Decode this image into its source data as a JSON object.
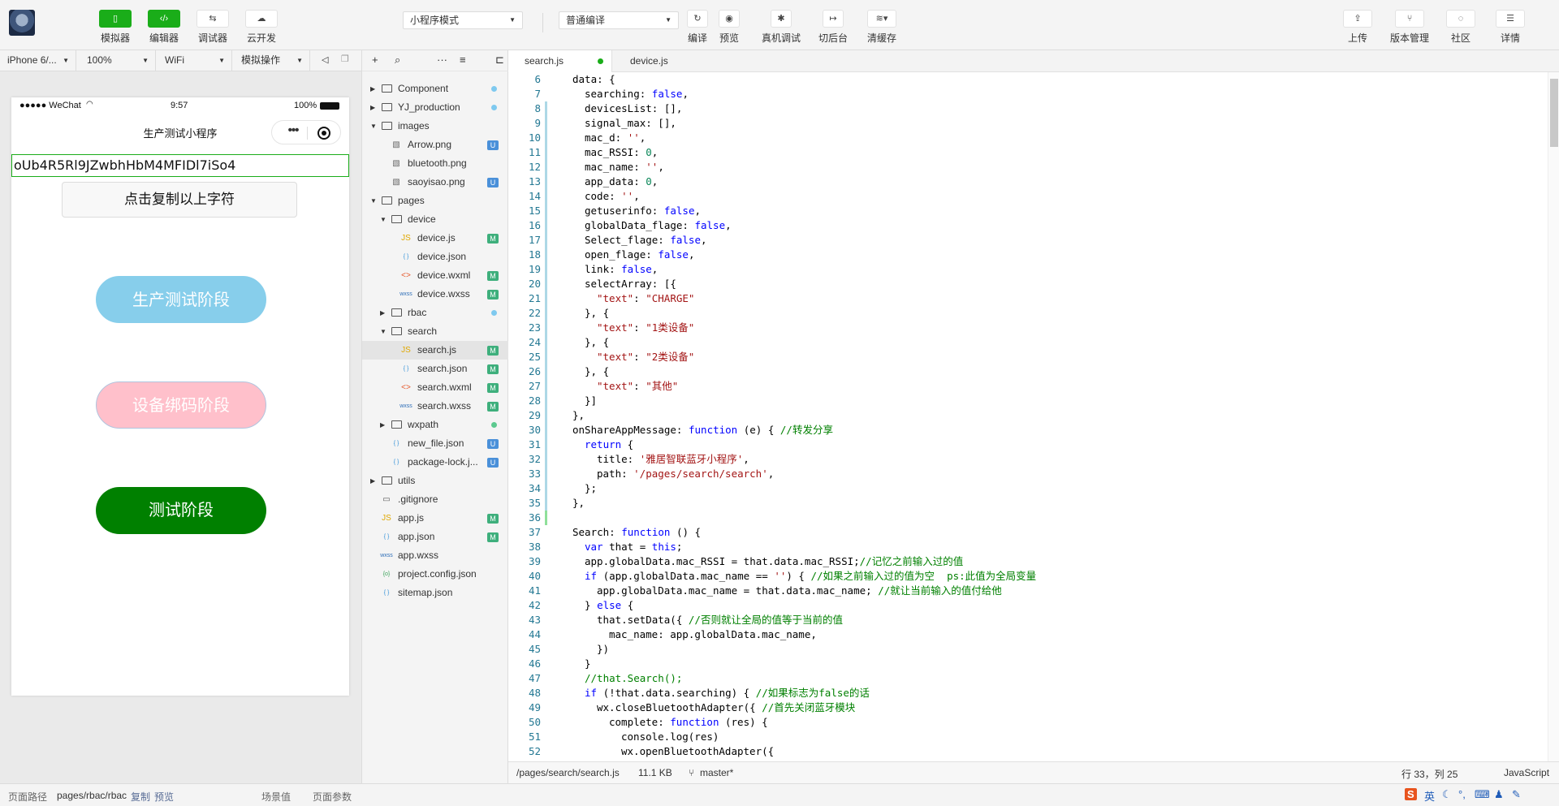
{
  "toolbar": {
    "left_buttons": [
      {
        "label": "模拟器",
        "icon": "phone-icon"
      },
      {
        "label": "编辑器",
        "icon": "code-icon"
      },
      {
        "label": "调试器",
        "icon": "debug-icon"
      },
      {
        "label": "云开发",
        "icon": "cloud-icon"
      }
    ],
    "mode_select": "小程序模式",
    "compile_select": "普通编译",
    "mid_buttons": [
      {
        "label": "编译",
        "icon": "refresh-icon"
      },
      {
        "label": "预览",
        "icon": "eye-icon"
      },
      {
        "label": "真机调试",
        "icon": "bug-icon"
      },
      {
        "label": "切后台",
        "icon": "background-icon"
      },
      {
        "label": "清缓存",
        "icon": "layers-icon"
      }
    ],
    "right_buttons": [
      {
        "label": "上传",
        "icon": "upload-icon"
      },
      {
        "label": "版本管理",
        "icon": "branch-icon"
      },
      {
        "label": "社区",
        "icon": "chat-icon"
      },
      {
        "label": "详情",
        "icon": "menu-icon"
      }
    ]
  },
  "simbar": {
    "device": "iPhone 6/...",
    "zoom": "100%",
    "network": "WiFi",
    "operation": "模拟操作"
  },
  "phone": {
    "carrier": "●●●●● WeChat",
    "time": "9:57",
    "battery": "100%",
    "nav_title": "生产测试小程序",
    "openid": "oUb4R5Rl9JZwbhHbM4MFIDl7iSo4",
    "copy_button": "点击复制以上字符",
    "btn_production": "生产测试阶段",
    "btn_binding": "设备绑码阶段",
    "btn_test": "测试阶段"
  },
  "explorer": {
    "tree": [
      {
        "name": "Component",
        "type": "folder",
        "depth": 0,
        "open": false,
        "badge": "dotblue"
      },
      {
        "name": "YJ_production",
        "type": "folder",
        "depth": 0,
        "open": false,
        "badge": "dotblue"
      },
      {
        "name": "images",
        "type": "folder",
        "depth": 0,
        "open": true,
        "badge": ""
      },
      {
        "name": "Arrow.png",
        "type": "img",
        "depth": 1,
        "badge": "U"
      },
      {
        "name": "bluetooth.png",
        "type": "img",
        "depth": 1,
        "badge": ""
      },
      {
        "name": "saoyisao.png",
        "type": "img",
        "depth": 1,
        "badge": "U"
      },
      {
        "name": "pages",
        "type": "folder",
        "depth": 0,
        "open": true,
        "badge": ""
      },
      {
        "name": "device",
        "type": "folder",
        "depth": 1,
        "open": true,
        "badge": ""
      },
      {
        "name": "device.js",
        "type": "js",
        "depth": 2,
        "badge": "M"
      },
      {
        "name": "device.json",
        "type": "json",
        "depth": 2,
        "badge": ""
      },
      {
        "name": "device.wxml",
        "type": "wxml",
        "depth": 2,
        "badge": "M"
      },
      {
        "name": "device.wxss",
        "type": "wxss",
        "depth": 2,
        "badge": "M"
      },
      {
        "name": "rbac",
        "type": "folder",
        "depth": 1,
        "open": false,
        "badge": "dotblue"
      },
      {
        "name": "search",
        "type": "folder",
        "depth": 1,
        "open": true,
        "badge": ""
      },
      {
        "name": "search.js",
        "type": "js",
        "depth": 2,
        "badge": "M",
        "active": true
      },
      {
        "name": "search.json",
        "type": "json",
        "depth": 2,
        "badge": "M"
      },
      {
        "name": "search.wxml",
        "type": "wxml",
        "depth": 2,
        "badge": "M"
      },
      {
        "name": "search.wxss",
        "type": "wxss",
        "depth": 2,
        "badge": "M"
      },
      {
        "name": "wxpath",
        "type": "folder",
        "depth": 1,
        "open": false,
        "badge": "dotgreen"
      },
      {
        "name": "new_file.json",
        "type": "json",
        "depth": 1,
        "badge": "U"
      },
      {
        "name": "package-lock.j...",
        "type": "json",
        "depth": 1,
        "badge": "U"
      },
      {
        "name": "utils",
        "type": "folder",
        "depth": 0,
        "open": false,
        "badge": ""
      },
      {
        "name": ".gitignore",
        "type": "file",
        "depth": 0,
        "badge": ""
      },
      {
        "name": "app.js",
        "type": "js",
        "depth": 0,
        "badge": "M"
      },
      {
        "name": "app.json",
        "type": "json",
        "depth": 0,
        "badge": "M"
      },
      {
        "name": "app.wxss",
        "type": "wxss",
        "depth": 0,
        "badge": ""
      },
      {
        "name": "project.config.json",
        "type": "cfg",
        "depth": 0,
        "badge": ""
      },
      {
        "name": "sitemap.json",
        "type": "json",
        "depth": 0,
        "badge": ""
      }
    ]
  },
  "editor": {
    "tabs": [
      {
        "label": "search.js",
        "active": true,
        "modified": true
      },
      {
        "label": "device.js",
        "active": false,
        "modified": false
      }
    ],
    "lines": [
      {
        "n": "6",
        "g": "",
        "ind": 0,
        "parts": [
          [
            "",
            "data: {"
          ]
        ]
      },
      {
        "n": "7",
        "g": "",
        "ind": 1,
        "parts": [
          [
            "",
            "searching: "
          ],
          [
            "k",
            "false"
          ],
          [
            "",
            ","
          ]
        ]
      },
      {
        "n": "8",
        "g": "mod",
        "ind": 1,
        "parts": [
          [
            "",
            "devicesList: [],"
          ]
        ]
      },
      {
        "n": "9",
        "g": "mod",
        "ind": 1,
        "parts": [
          [
            "",
            "signal_max: [],"
          ]
        ]
      },
      {
        "n": "10",
        "g": "mod",
        "ind": 1,
        "parts": [
          [
            "",
            "mac_d: "
          ],
          [
            "s",
            "''"
          ],
          [
            "",
            ","
          ]
        ]
      },
      {
        "n": "11",
        "g": "mod",
        "ind": 1,
        "parts": [
          [
            "",
            "mac_RSSI: "
          ],
          [
            "n",
            "0"
          ],
          [
            "",
            ","
          ]
        ]
      },
      {
        "n": "12",
        "g": "mod",
        "ind": 1,
        "parts": [
          [
            "",
            "mac_name: "
          ],
          [
            "s",
            "''"
          ],
          [
            "",
            ","
          ]
        ]
      },
      {
        "n": "13",
        "g": "mod",
        "ind": 1,
        "parts": [
          [
            "",
            "app_data: "
          ],
          [
            "n",
            "0"
          ],
          [
            "",
            ","
          ]
        ]
      },
      {
        "n": "14",
        "g": "mod",
        "ind": 1,
        "parts": [
          [
            "",
            "code: "
          ],
          [
            "s",
            "''"
          ],
          [
            "",
            ","
          ]
        ]
      },
      {
        "n": "15",
        "g": "mod",
        "ind": 1,
        "parts": [
          [
            "",
            "getuserinfo: "
          ],
          [
            "k",
            "false"
          ],
          [
            "",
            ","
          ]
        ]
      },
      {
        "n": "16",
        "g": "mod",
        "ind": 1,
        "parts": [
          [
            "",
            "globalData_flage: "
          ],
          [
            "k",
            "false"
          ],
          [
            "",
            ","
          ]
        ]
      },
      {
        "n": "17",
        "g": "mod",
        "ind": 1,
        "parts": [
          [
            "",
            "Select_flage: "
          ],
          [
            "k",
            "false"
          ],
          [
            "",
            ","
          ]
        ]
      },
      {
        "n": "18",
        "g": "mod",
        "ind": 1,
        "parts": [
          [
            "",
            "open_flage: "
          ],
          [
            "k",
            "false"
          ],
          [
            "",
            ","
          ]
        ]
      },
      {
        "n": "19",
        "g": "mod",
        "ind": 1,
        "parts": [
          [
            "",
            "link: "
          ],
          [
            "k",
            "false"
          ],
          [
            "",
            ","
          ]
        ]
      },
      {
        "n": "20",
        "g": "mod",
        "ind": 1,
        "parts": [
          [
            "",
            "selectArray: [{"
          ]
        ]
      },
      {
        "n": "21",
        "g": "mod",
        "ind": 2,
        "parts": [
          [
            "s",
            "\"text\""
          ],
          [
            "",
            ": "
          ],
          [
            "s",
            "\"CHARGE\""
          ]
        ]
      },
      {
        "n": "22",
        "g": "mod",
        "ind": 1,
        "parts": [
          [
            "",
            "}, {"
          ]
        ]
      },
      {
        "n": "23",
        "g": "mod",
        "ind": 2,
        "parts": [
          [
            "s",
            "\"text\""
          ],
          [
            "",
            ": "
          ],
          [
            "s",
            "\"1类设备\""
          ]
        ]
      },
      {
        "n": "24",
        "g": "mod",
        "ind": 1,
        "parts": [
          [
            "",
            "}, {"
          ]
        ]
      },
      {
        "n": "25",
        "g": "mod",
        "ind": 2,
        "parts": [
          [
            "s",
            "\"text\""
          ],
          [
            "",
            ": "
          ],
          [
            "s",
            "\"2类设备\""
          ]
        ]
      },
      {
        "n": "26",
        "g": "mod",
        "ind": 1,
        "parts": [
          [
            "",
            "}, {"
          ]
        ]
      },
      {
        "n": "27",
        "g": "mod",
        "ind": 2,
        "parts": [
          [
            "s",
            "\"text\""
          ],
          [
            "",
            ": "
          ],
          [
            "s",
            "\"其他\""
          ]
        ]
      },
      {
        "n": "28",
        "g": "mod",
        "ind": 1,
        "parts": [
          [
            "",
            "}]"
          ]
        ]
      },
      {
        "n": "29",
        "g": "mod",
        "ind": 0,
        "parts": [
          [
            "",
            "},"
          ]
        ]
      },
      {
        "n": "30",
        "g": "mod",
        "ind": 0,
        "parts": [
          [
            "",
            "onShareAppMessage: "
          ],
          [
            "k",
            "function"
          ],
          [
            "",
            " (e) { "
          ],
          [
            "c",
            "//转发分享"
          ]
        ]
      },
      {
        "n": "31",
        "g": "mod",
        "ind": 1,
        "parts": [
          [
            "k",
            "return"
          ],
          [
            "",
            " {"
          ]
        ]
      },
      {
        "n": "32",
        "g": "mod",
        "ind": 2,
        "parts": [
          [
            "",
            "title: "
          ],
          [
            "s",
            "'雅居智联蓝牙小程序'"
          ],
          [
            "",
            ","
          ]
        ]
      },
      {
        "n": "33",
        "g": "mod",
        "ind": 2,
        "parts": [
          [
            "",
            "path: "
          ],
          [
            "s",
            "'/pages/search/search'"
          ],
          [
            "",
            ","
          ]
        ]
      },
      {
        "n": "34",
        "g": "mod",
        "ind": 1,
        "parts": [
          [
            "",
            "};"
          ]
        ]
      },
      {
        "n": "35",
        "g": "mod",
        "ind": 0,
        "parts": [
          [
            "",
            "},"
          ]
        ]
      },
      {
        "n": "36",
        "g": "add",
        "ind": 0,
        "parts": [
          [
            "",
            ""
          ]
        ]
      },
      {
        "n": "37",
        "g": "",
        "ind": 0,
        "parts": [
          [
            "",
            "Search: "
          ],
          [
            "k",
            "function"
          ],
          [
            "",
            " () {"
          ]
        ]
      },
      {
        "n": "38",
        "g": "",
        "ind": 1,
        "parts": [
          [
            "k",
            "var"
          ],
          [
            "",
            " that = "
          ],
          [
            "k",
            "this"
          ],
          [
            "",
            ";"
          ]
        ]
      },
      {
        "n": "39",
        "g": "",
        "ind": 1,
        "parts": [
          [
            "",
            "app.globalData.mac_RSSI = that.data.mac_RSSI;"
          ],
          [
            "c",
            "//记忆之前输入过的值"
          ]
        ]
      },
      {
        "n": "40",
        "g": "",
        "ind": 1,
        "parts": [
          [
            "k",
            "if"
          ],
          [
            "",
            " (app.globalData.mac_name == "
          ],
          [
            "s",
            "''"
          ],
          [
            "",
            ") { "
          ],
          [
            "c",
            "//如果之前输入过的值为空  ps:此值为全局变量"
          ]
        ]
      },
      {
        "n": "41",
        "g": "",
        "ind": 2,
        "parts": [
          [
            "",
            "app.globalData.mac_name = that.data.mac_name; "
          ],
          [
            "c",
            "//就让当前输入的值付给他"
          ]
        ]
      },
      {
        "n": "42",
        "g": "",
        "ind": 1,
        "parts": [
          [
            "",
            "} "
          ],
          [
            "k",
            "else"
          ],
          [
            "",
            " {"
          ]
        ]
      },
      {
        "n": "43",
        "g": "",
        "ind": 2,
        "parts": [
          [
            "",
            "that.setData({ "
          ],
          [
            "c",
            "//否则就让全局的值等于当前的值"
          ]
        ]
      },
      {
        "n": "44",
        "g": "",
        "ind": 3,
        "parts": [
          [
            "",
            "mac_name: app.globalData.mac_name,"
          ]
        ]
      },
      {
        "n": "45",
        "g": "",
        "ind": 2,
        "parts": [
          [
            "",
            "})"
          ]
        ]
      },
      {
        "n": "46",
        "g": "",
        "ind": 1,
        "parts": [
          [
            "",
            "}"
          ]
        ]
      },
      {
        "n": "47",
        "g": "",
        "ind": 1,
        "parts": [
          [
            "c",
            "//that.Search();"
          ]
        ]
      },
      {
        "n": "48",
        "g": "",
        "ind": 1,
        "parts": [
          [
            "k",
            "if"
          ],
          [
            "",
            " (!that.data.searching) { "
          ],
          [
            "c",
            "//如果标志为false的话"
          ]
        ]
      },
      {
        "n": "49",
        "g": "",
        "ind": 2,
        "parts": [
          [
            "",
            "wx.closeBluetoothAdapter({ "
          ],
          [
            "c",
            "//首先关闭蓝牙模块"
          ]
        ]
      },
      {
        "n": "50",
        "g": "",
        "ind": 3,
        "parts": [
          [
            "",
            "complete: "
          ],
          [
            "k",
            "function"
          ],
          [
            "",
            " (res) {"
          ]
        ]
      },
      {
        "n": "51",
        "g": "",
        "ind": 4,
        "parts": [
          [
            "",
            "console.log(res)"
          ]
        ]
      },
      {
        "n": "52",
        "g": "",
        "ind": 4,
        "parts": [
          [
            "",
            "wx.openBluetoothAdapter({"
          ]
        ]
      }
    ],
    "status": {
      "path": "/pages/search/search.js",
      "size": "11.1 KB",
      "branch": "master*",
      "cursor": "行 33，列 25",
      "language": "JavaScript"
    }
  },
  "bottom": {
    "path_label": "页面路径",
    "path_value": "pages/rbac/rbac",
    "copy": "复制",
    "preview": "预览",
    "scene": "场景值",
    "params": "页面参数"
  },
  "tray": {
    "ime": "英"
  }
}
